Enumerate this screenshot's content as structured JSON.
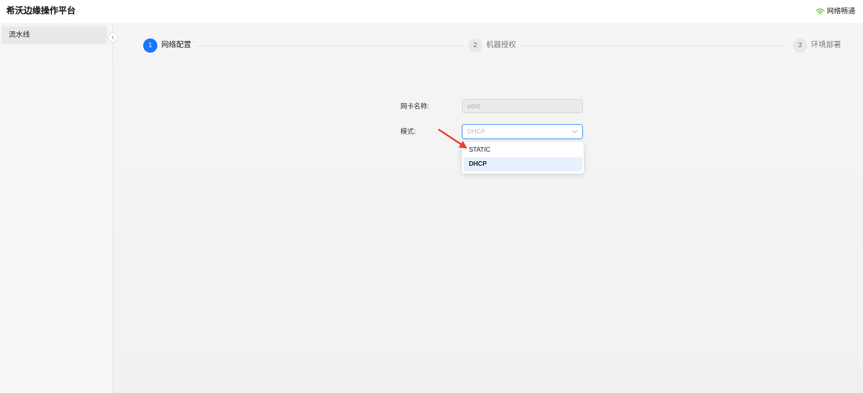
{
  "header": {
    "title": "希沃边缘操作平台",
    "network_status": "网络畅通",
    "status_icon": "wifi-icon"
  },
  "sidebar": {
    "items": [
      {
        "label": "流水线",
        "active": true
      }
    ],
    "collapse_icon": "chevron-left-icon"
  },
  "steps": [
    {
      "number": "1",
      "label": "网络配置",
      "active": true
    },
    {
      "number": "2",
      "label": "机器授权",
      "active": false
    },
    {
      "number": "3",
      "label": "环境部署",
      "active": false
    }
  ],
  "form": {
    "nic_name": {
      "label": "网卡名称:",
      "value": "eth0",
      "disabled": true
    },
    "mode": {
      "label": "模式:",
      "placeholder": "DHCP",
      "dropdown_icon": "chevron-down-icon",
      "open": true,
      "options": [
        {
          "label": "STATIC",
          "selected": false
        },
        {
          "label": "DHCP",
          "selected": true
        }
      ]
    }
  },
  "annotation_icon": "red-arrow-icon",
  "colors": {
    "accent": "#1677ff",
    "status_ok": "#52c41a",
    "annotation": "#e8412f",
    "option_selected_bg": "#e6f0fe"
  }
}
